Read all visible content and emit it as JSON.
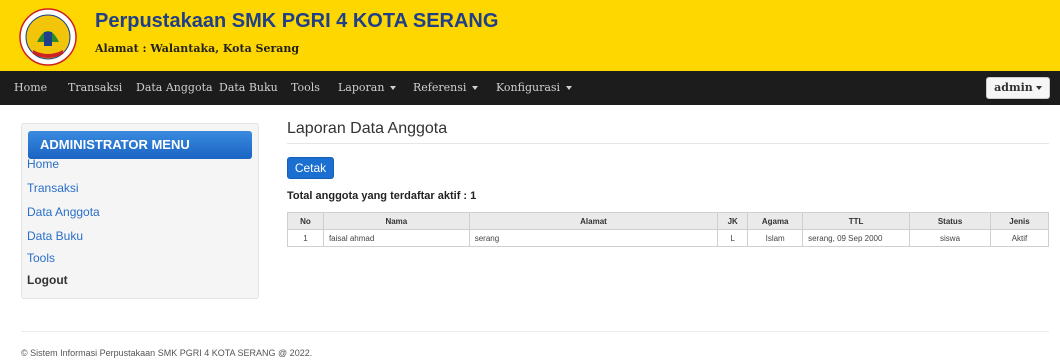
{
  "header": {
    "title": "Perpustakaan SMK PGRI 4 KOTA SERANG",
    "address": "Alamat : Walantaka, Kota Serang",
    "logo_text": "SMK PGRI 4 KOTA SERANG BANTEN"
  },
  "navbar": {
    "items": [
      {
        "label": "Home"
      },
      {
        "label": "Transaksi"
      },
      {
        "label": "Data Anggota"
      },
      {
        "label": "Data Buku"
      },
      {
        "label": "Tools"
      },
      {
        "label": "Laporan"
      },
      {
        "label": "Referensi"
      },
      {
        "label": "Konfigurasi"
      }
    ],
    "user": "admin"
  },
  "sidebar": {
    "heading": "ADMINISTRATOR MENU",
    "items": [
      {
        "label": "Home"
      },
      {
        "label": "Transaksi"
      },
      {
        "label": "Data Anggota"
      },
      {
        "label": "Data Buku"
      },
      {
        "label": "Tools"
      },
      {
        "label": "Logout"
      }
    ]
  },
  "main": {
    "title": "Laporan Data Anggota",
    "print_button": "Cetak",
    "summary": "Total anggota yang terdaftar aktif : 1",
    "table": {
      "headers": [
        "No",
        "Nama",
        "Alamat",
        "JK",
        "Agama",
        "TTL",
        "Status",
        "Jenis"
      ],
      "rows": [
        [
          "1",
          "faisal ahmad",
          "serang",
          "L",
          "Islam",
          "serang, 09 Sep 2000",
          "siswa",
          "Aktif"
        ]
      ]
    }
  },
  "footer": {
    "text": "© Sistem Informasi Perpustakaan SMK PGRI 4 KOTA SERANG @ 2022."
  },
  "colors": {
    "header_bg": "#ffd700",
    "navbar_bg": "#1c1c1c",
    "title_color": "#1f3f88",
    "accent": "#1a6fd1"
  }
}
